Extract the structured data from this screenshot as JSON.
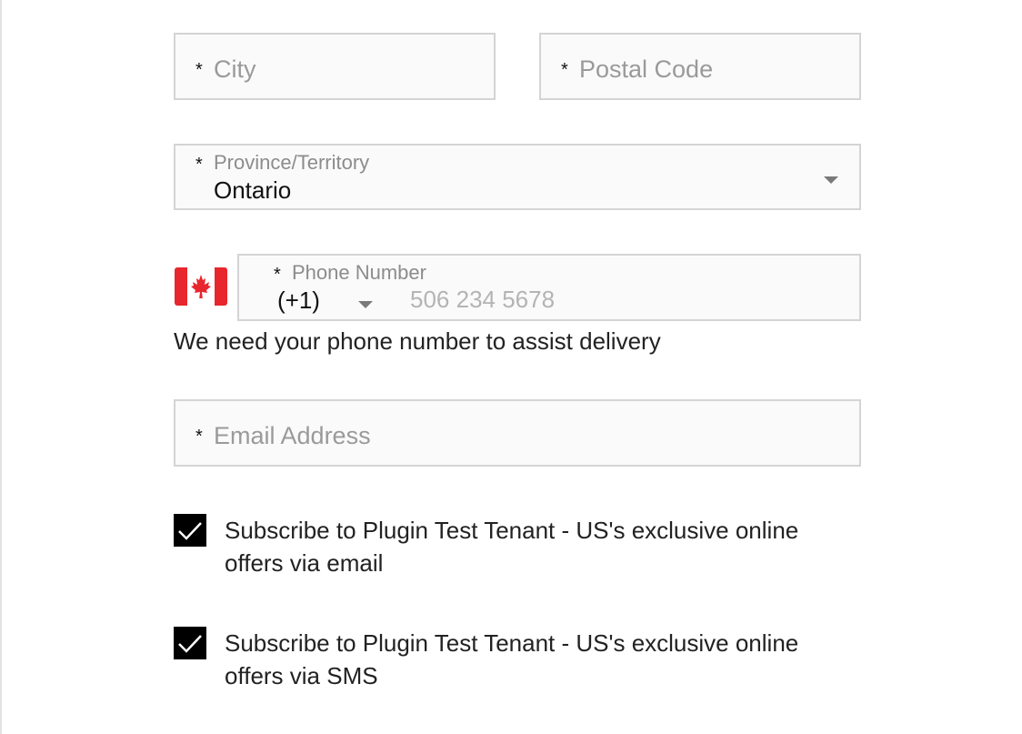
{
  "form": {
    "city": {
      "required_mark": "*",
      "placeholder": "City"
    },
    "postal_code": {
      "required_mark": "*",
      "placeholder": "Postal Code"
    },
    "province": {
      "required_mark": "*",
      "label": "Province/Territory",
      "value": "Ontario"
    },
    "phone": {
      "flag_icon": "canada-flag-icon",
      "required_mark": "*",
      "label": "Phone Number",
      "country_code": "(+1)",
      "placeholder": "506 234 5678",
      "helper": "We need your phone number to assist delivery"
    },
    "email": {
      "required_mark": "*",
      "placeholder": "Email Address"
    },
    "subscribe_email": {
      "checked": true,
      "label": "Subscribe to Plugin Test Tenant - US's exclusive online offers via email"
    },
    "subscribe_sms": {
      "checked": true,
      "label": "Subscribe to Plugin Test Tenant - US's exclusive online offers via SMS"
    }
  },
  "colors": {
    "field_bg": "#fafafa",
    "field_border": "#d4d4d4",
    "checkbox": "#000000",
    "flag_red": "#e8262d"
  }
}
